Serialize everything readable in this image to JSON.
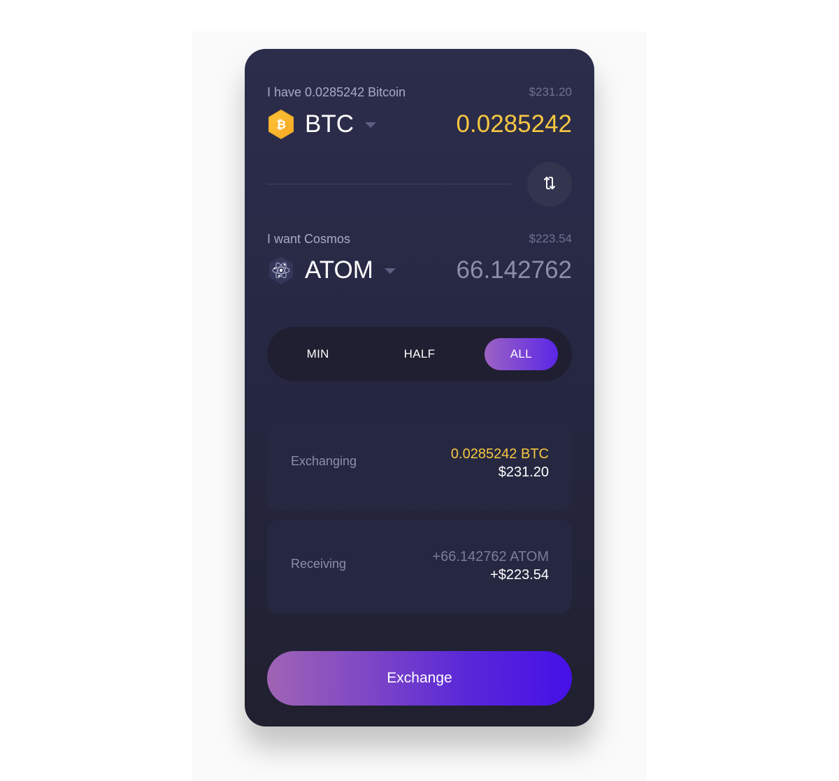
{
  "from": {
    "label": "I have 0.0285242 Bitcoin",
    "usd": "$231.20",
    "ticker": "BTC",
    "amount": "0.0285242",
    "icon": "bitcoin-icon"
  },
  "swap": {
    "icon": "swap-arrows-icon"
  },
  "to": {
    "label": "I want Cosmos",
    "usd": "$223.54",
    "ticker": "ATOM",
    "amount": "66.142762",
    "icon": "cosmos-atom-icon"
  },
  "amount_selector": {
    "options": [
      "MIN",
      "HALF",
      "ALL"
    ],
    "selected": "ALL"
  },
  "summary": {
    "exchanging": {
      "label": "Exchanging",
      "crypto": "0.0285242 BTC",
      "fiat": "$231.20"
    },
    "receiving": {
      "label": "Receiving",
      "crypto": "+66.142762 ATOM",
      "fiat": "+$223.54"
    }
  },
  "actions": {
    "exchange_label": "Exchange"
  },
  "colors": {
    "accent_yellow": "#f7c842",
    "gradient_start": "#a064b4",
    "gradient_end": "#4510e6",
    "card_bg": "#262843"
  }
}
